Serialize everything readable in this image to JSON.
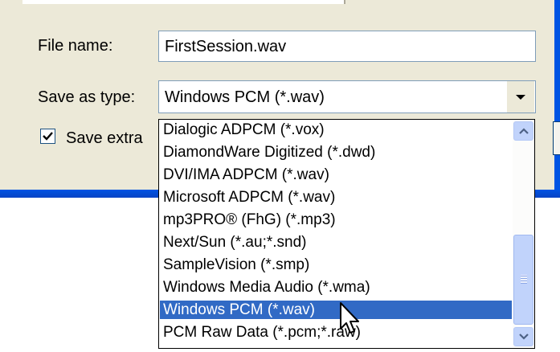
{
  "form": {
    "file_name_label": "File name:",
    "file_name_value": "FirstSession.wav",
    "save_as_type_label": "Save as type:",
    "save_as_type_value": "Windows PCM (*.wav)",
    "save_extra_label": "Save extra",
    "save_extra_checked": true
  },
  "dropdown": {
    "selected_index": 8,
    "options": [
      "Dialogic ADPCM (*.vox)",
      "DiamondWare Digitized (*.dwd)",
      "DVI/IMA ADPCM (*.wav)",
      "Microsoft ADPCM (*.wav)",
      "mp3PRO® (FhG) (*.mp3)",
      "Next/Sun (*.au;*.snd)",
      "SampleVision (*.smp)",
      "Windows Media Audio (*.wma)",
      "Windows PCM (*.wav)",
      "PCM Raw Data (*.pcm;*.raw)"
    ]
  },
  "colors": {
    "dialog_bg": "#ece9d8",
    "selection": "#316ac5",
    "frame_blue": "#0054e3"
  }
}
